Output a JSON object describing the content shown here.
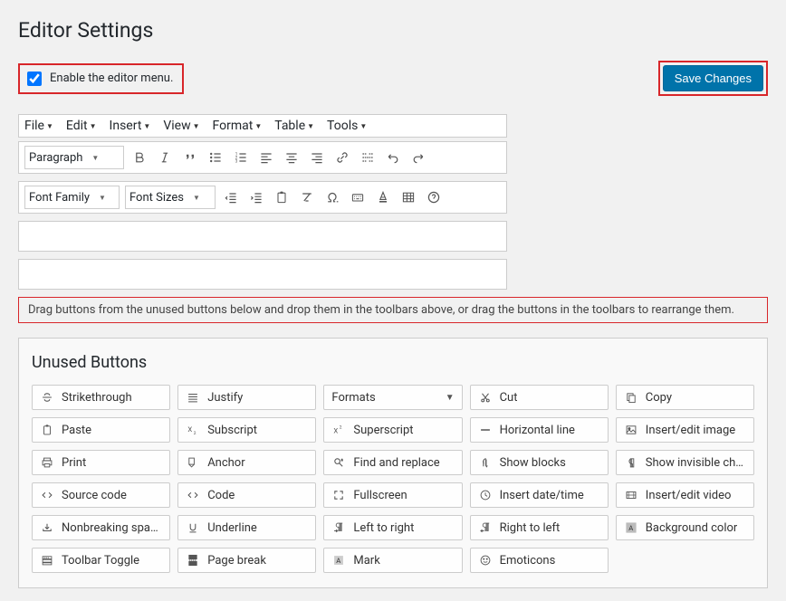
{
  "title": "Editor Settings",
  "enableLabel": "Enable the editor menu.",
  "saveLabel": "Save Changes",
  "menus": [
    "File",
    "Edit",
    "Insert",
    "View",
    "Format",
    "Table",
    "Tools"
  ],
  "formatDropdown": "Paragraph",
  "fontFamilyLabel": "Font Family",
  "fontSizesLabel": "Font Sizes",
  "instructions": "Drag buttons from the unused buttons below and drop them in the toolbars above, or drag the buttons in the toolbars to rearrange them.",
  "unusedTitle": "Unused Buttons",
  "unused": {
    "strikethrough": "Strikethrough",
    "justify": "Justify",
    "formats": "Formats",
    "cut": "Cut",
    "copy": "Copy",
    "paste": "Paste",
    "subscript": "Subscript",
    "superscript": "Superscript",
    "hr": "Horizontal line",
    "image": "Insert/edit image",
    "print": "Print",
    "anchor": "Anchor",
    "findreplace": "Find and replace",
    "showblocks": "Show blocks",
    "showinvisible": "Show invisible chara...",
    "sourcecode": "Source code",
    "code": "Code",
    "fullscreen": "Fullscreen",
    "datetime": "Insert date/time",
    "video": "Insert/edit video",
    "nbsp": "Nonbreaking space",
    "underline": "Underline",
    "ltr": "Left to right",
    "rtl": "Right to left",
    "bgcolor": "Background color",
    "toolbartoggle": "Toolbar Toggle",
    "pagebreak": "Page break",
    "mark": "Mark",
    "emoticons": "Emoticons"
  }
}
